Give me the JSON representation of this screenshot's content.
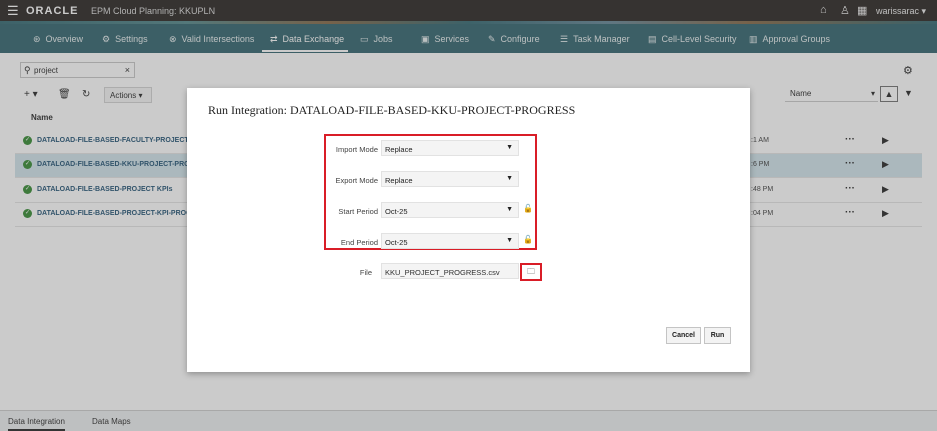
{
  "topbar": {
    "menu_icon": "hamburger-icon",
    "logo": "ORACLE",
    "app_title": "EPM Cloud Planning: KKUPLN",
    "user": "warissarac ▾",
    "icons": [
      "home-icon",
      "accessibility-icon",
      "navigator-icon"
    ]
  },
  "nav": {
    "overview": "Overview",
    "settings": "Settings",
    "valid_intersections": "Valid Intersections",
    "data_exchange": "Data Exchange",
    "jobs": "Jobs",
    "services": "Services",
    "configure": "Configure",
    "task_manager": "Task Manager",
    "cell_level_security": "Cell-Level Security",
    "approval_groups": "Approval Groups"
  },
  "toolbar": {
    "search_value": "project",
    "actions_label": "Actions ▾",
    "sort_label": "Name"
  },
  "list": {
    "column_name": "Name",
    "rows": [
      {
        "name": "DATALOAD-FILE-BASED-FACULTY-PROJECT-PRO",
        "time": ":1 AM"
      },
      {
        "name": "DATALOAD-FILE-BASED-KKU-PROJECT-PROGRE",
        "time": ":6 PM"
      },
      {
        "name": "DATALOAD-FILE-BASED-PROJECT KPIs",
        "time": ":48 PM"
      },
      {
        "name": "DATALOAD-FILE-BASED-PROJECT-KPI-PROGRES",
        "time": ":04 PM"
      }
    ]
  },
  "bottom_tabs": {
    "data_integration": "Data Integration",
    "data_maps": "Data Maps"
  },
  "dialog": {
    "title": "Run Integration: DATALOAD-FILE-BASED-KKU-PROJECT-PROGRESS",
    "import_mode_label": "Import Mode",
    "import_mode_value": "Replace",
    "export_mode_label": "Export Mode",
    "export_mode_value": "Replace",
    "start_period_label": "Start Period",
    "start_period_value": "Oct-25",
    "end_period_label": "End Period",
    "end_period_value": "Oct-25",
    "file_label": "File",
    "file_value": "KKU_PROJECT_PROGRESS.csv",
    "cancel_label": "Cancel",
    "run_label": "Run"
  },
  "colors": {
    "topbar": "#312d2a",
    "navbar": "#3a6a73",
    "highlight_box": "#d91d27",
    "success": "#3c8f3a"
  }
}
